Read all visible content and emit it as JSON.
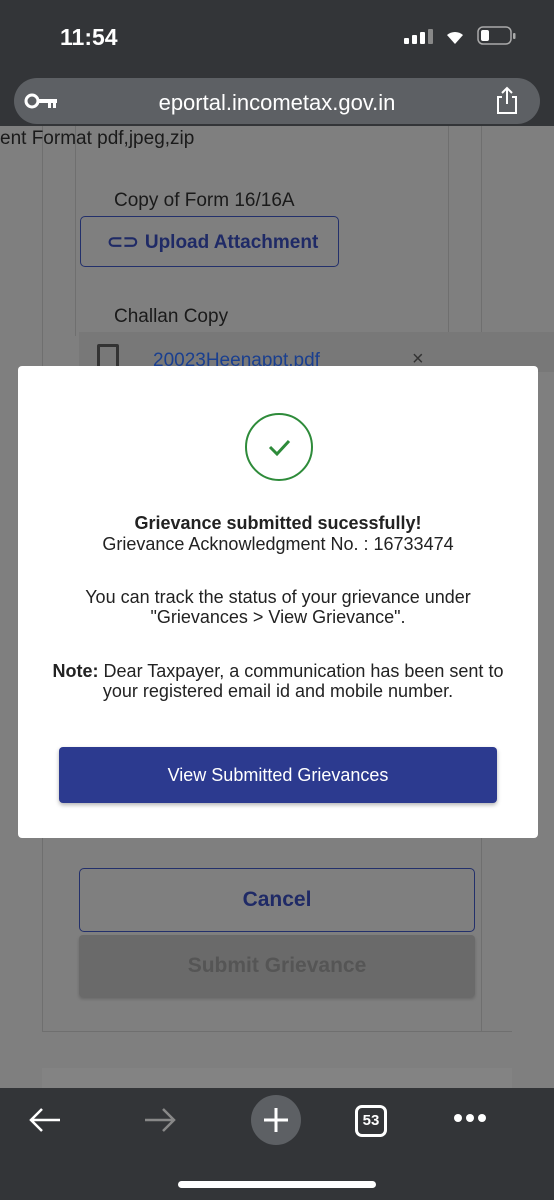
{
  "status_bar": {
    "time": "11:54"
  },
  "browser": {
    "url": "eportal.incometax.gov.in",
    "tab_count": "53"
  },
  "background_form": {
    "format_text": "ent Format pdf,jpeg,zip",
    "form16_label": "Copy of Form 16/16A",
    "upload_label": "Upload Attachment",
    "challan_label": "Challan Copy",
    "file_name": "20023Heenappt.pdf",
    "cancel_label": "Cancel",
    "submit_label": "Submit Grievance"
  },
  "modal": {
    "title": "Grievance submitted sucessfully!",
    "ack": "Grievance Acknowledgment No. : 16733474",
    "track_text": "You can track the status of your grievance under \"Grievances > View Grievance\".",
    "note_label": "Note:",
    "note_text": " Dear Taxpayer, a communication has been sent to your registered email id and mobile number.",
    "button_label": "View Submitted Grievances",
    "success_color": "#2e8b3a",
    "accent_color": "#2c3a8f"
  }
}
